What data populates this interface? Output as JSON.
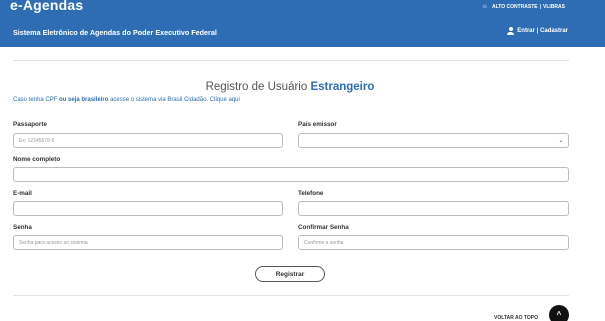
{
  "header": {
    "logo": "e-Agendas",
    "site_title": "Sistema Eletrônico de Agendas do Poder Executivo Federal",
    "accessibility": {
      "contrast_icon": "sun-icon",
      "contrast_label": "ALTO CONTRASTE",
      "separator": "|",
      "vlibras_label": "VLIBRAS"
    },
    "login": {
      "icon": "user-icon",
      "label": "Entrar | Cadastrar"
    },
    "background_color": "#2e6db4"
  },
  "form": {
    "title_prefix": "Registro de Usuário",
    "title_emphasis": "Estrangeiro",
    "hint": {
      "before": "Caso tenha CPF",
      "emphasis": "ou seja brasileiro",
      "after": "acesse o sistema via Brasil Cidadão. Clique aqui"
    },
    "fields": {
      "passport": {
        "label": "Passaporte",
        "placeholder": "Ex: 12345678-9",
        "value": ""
      },
      "country": {
        "label": "País emissor",
        "value": ""
      },
      "full_name": {
        "label": "Nome completo",
        "value": ""
      },
      "email": {
        "label": "E-mail",
        "value": ""
      },
      "phone": {
        "label": "Telefone",
        "value": ""
      },
      "password": {
        "label": "Senha",
        "placeholder": "Senha para acesso ao sistema",
        "value": ""
      },
      "confirm_password": {
        "label": "Confirmar Senha",
        "placeholder": "Confirme a senha",
        "value": ""
      }
    },
    "submit_label": "Registrar"
  },
  "footer": {
    "back_to_top_label": "VOLTAR AO TOPO",
    "back_to_top_icon": "chevron-up-icon"
  },
  "colors": {
    "accent": "#2e6db4",
    "back_to_top_button": "#111111"
  }
}
